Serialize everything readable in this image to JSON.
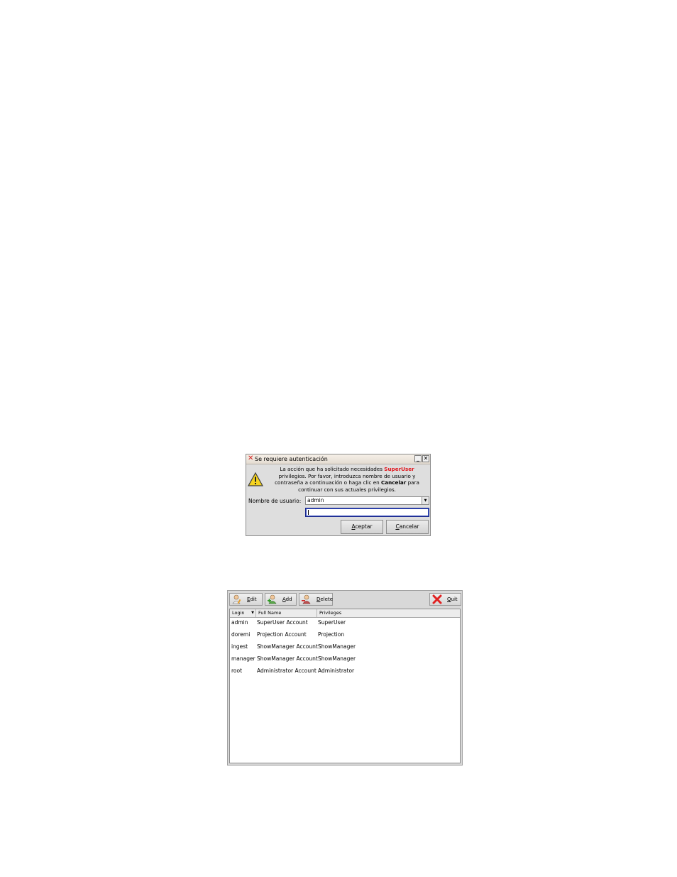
{
  "auth_dialog": {
    "title": "Se requiere autenticación",
    "message": {
      "part1": "La acción que ha solicitado necesidades ",
      "superuser": "SuperUser",
      "part2": " privilegios. Por favor, introduzca nombre de usuario y contraseña a continuación o haga clic en ",
      "cancelar": "Cancelar",
      "part3": " para continuar con sus actuales privilegios."
    },
    "username_label": "Nombre de usuario:",
    "username_value": "admin",
    "password_value": "",
    "accept_first": "A",
    "accept_rest": "ceptar",
    "cancel_first": "C",
    "cancel_rest": "ancelar"
  },
  "user_manager": {
    "toolbar": {
      "edit": {
        "first": "E",
        "rest": "dit"
      },
      "add": {
        "first": "A",
        "rest": "dd"
      },
      "delete": {
        "first": "D",
        "rest": "elete"
      },
      "quit": {
        "first": "Q",
        "rest": "uit"
      }
    },
    "columns": [
      "Login",
      "Full Name",
      "Privileges"
    ],
    "rows": [
      {
        "login": "admin",
        "full_name": "SuperUser Account",
        "privileges": "SuperUser"
      },
      {
        "login": "doremi",
        "full_name": "Projection Account",
        "privileges": "Projection"
      },
      {
        "login": "ingest",
        "full_name": "ShowManager Account",
        "privileges": "ShowManager"
      },
      {
        "login": "manager",
        "full_name": "ShowManager Account",
        "privileges": "ShowManager"
      },
      {
        "login": "root",
        "full_name": "Administrator Account",
        "privileges": "Administrator"
      }
    ]
  }
}
